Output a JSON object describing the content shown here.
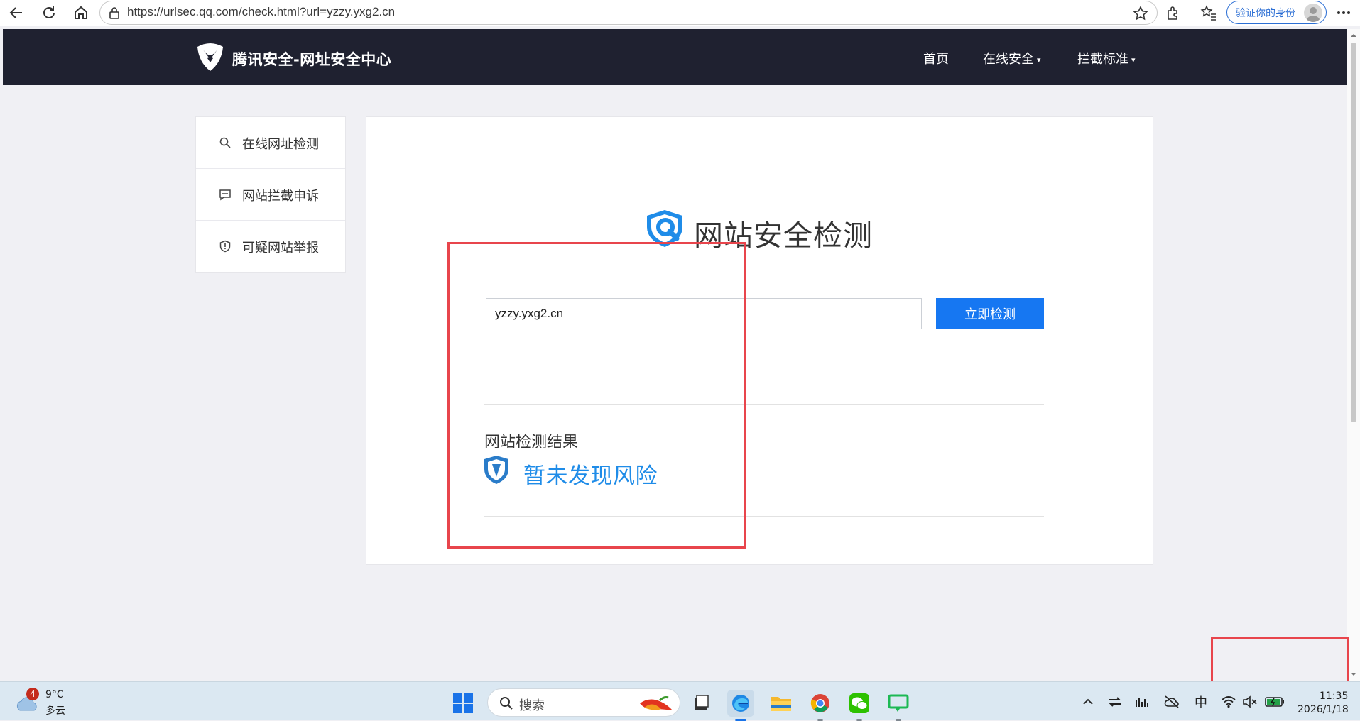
{
  "browser": {
    "url": "https://urlsec.qq.com/check.html?url=yzzy.yxg2.cn",
    "profile_label": "验证你的身份",
    "icons": [
      "back-icon",
      "refresh-icon",
      "home-icon",
      "lock-icon",
      "favorite-star-icon",
      "extensions-icon",
      "favorites-icon",
      "avatar",
      "more-icon"
    ]
  },
  "site": {
    "brand": "腾讯安全-网址安全中心",
    "nav": [
      {
        "label": "首页"
      },
      {
        "label": "在线安全",
        "caret": "▾"
      },
      {
        "label": "拦截标准",
        "caret": "▾"
      }
    ]
  },
  "sidebar": {
    "items": [
      {
        "label": "在线网址检测",
        "icon": "search-icon"
      },
      {
        "label": "网站拦截申诉",
        "icon": "message-icon"
      },
      {
        "label": "可疑网站举报",
        "icon": "shield-icon"
      }
    ]
  },
  "main": {
    "heading": "网站安全检测",
    "input_value": "yzzy.yxg2.cn",
    "check_button": "立即检测",
    "result_title": "网站检测结果",
    "result_text": "暂未发现风险",
    "colors": {
      "accent": "#1677f2",
      "result": "#1f8ce8",
      "header_bg": "#1f2130",
      "annotation": "#e8454c"
    }
  },
  "taskbar": {
    "weather": {
      "badge": "4",
      "temp": "9°C",
      "desc": "多云"
    },
    "search_label": "搜索",
    "apps": [
      "windows-start-icon",
      "file-viewer-icon",
      "edge-icon",
      "file-explorer-icon",
      "chrome-icon",
      "wechat-icon",
      "messages-icon"
    ],
    "ime": "中",
    "time": "11:35",
    "date": "2026/1/18"
  }
}
